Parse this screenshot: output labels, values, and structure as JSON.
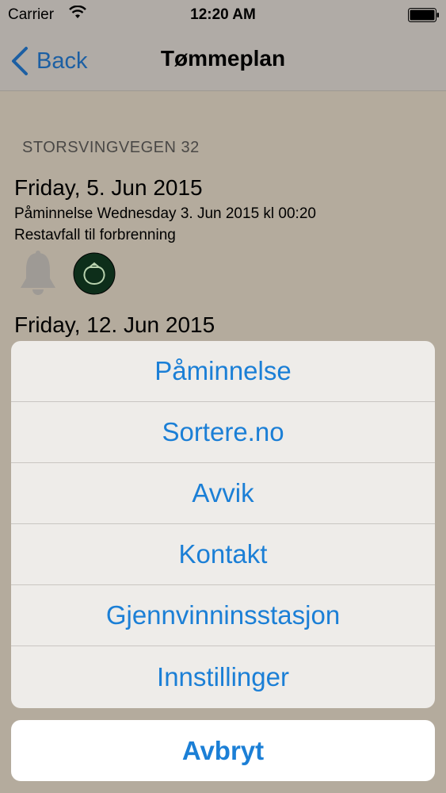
{
  "status_bar": {
    "carrier": "Carrier",
    "time": "12:20 AM"
  },
  "nav": {
    "back_label": "Back",
    "title": "Tømmeplan"
  },
  "content": {
    "section_header": "STORSVINGVEGEN 32",
    "entries": [
      {
        "date": "Friday, 5. Jun 2015",
        "reminder": "Påminnelse Wednesday 3. Jun 2015 kl 00:20",
        "waste_type": "Restavfall til forbrenning",
        "icons": [
          "bell-icon",
          "waste-sack-icon"
        ]
      },
      {
        "date": "Friday, 12. Jun 2015"
      }
    ]
  },
  "action_sheet": {
    "items": [
      "Påminnelse",
      "Sortere.no",
      "Avvik",
      "Kontakt",
      "Gjennvinninsstasjon",
      "Innstillinger"
    ],
    "cancel": "Avbryt"
  },
  "colors": {
    "accent": "#1b7fd6",
    "background": "#b4ab9d",
    "sack_fill": "#0d2e1a"
  }
}
